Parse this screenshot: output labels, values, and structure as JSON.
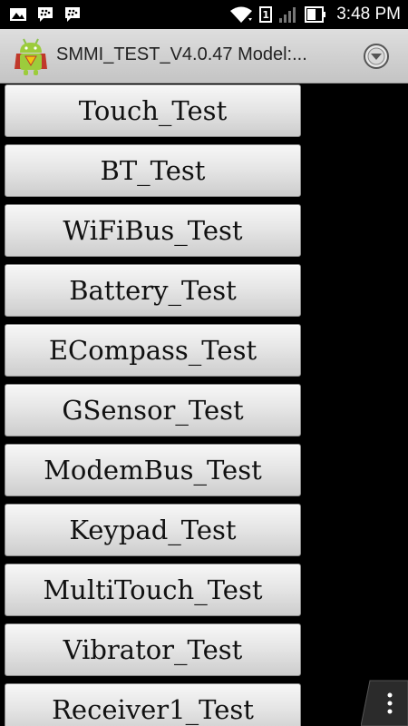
{
  "status_bar": {
    "time": "3:48 PM",
    "sim_slot": "1",
    "icons": [
      "image-notification-icon",
      "bbm-chat-icon",
      "bbm-chat-icon",
      "wifi-icon",
      "sim-slot-icon",
      "signal-icon",
      "battery-icon"
    ]
  },
  "action_bar": {
    "title": "SMMI_TEST_V4.0.47 Model:...",
    "icon": "android-superman-app-icon",
    "overflow_icon": "circle-chevron-down-icon"
  },
  "tests": [
    {
      "label": "Touch_Test"
    },
    {
      "label": "BT_Test"
    },
    {
      "label": "WiFiBus_Test"
    },
    {
      "label": "Battery_Test"
    },
    {
      "label": "ECompass_Test"
    },
    {
      "label": "GSensor_Test"
    },
    {
      "label": "ModemBus_Test"
    },
    {
      "label": "Keypad_Test"
    },
    {
      "label": "MultiTouch_Test"
    },
    {
      "label": "Vibrator_Test"
    },
    {
      "label": "Receiver1_Test"
    }
  ],
  "menu_tab": {
    "icon": "vertical-dots-menu-icon"
  },
  "colors": {
    "background": "#000000",
    "action_bar": "#d0d0d0",
    "button_face": "#e4e4e4",
    "button_text": "#111111"
  }
}
